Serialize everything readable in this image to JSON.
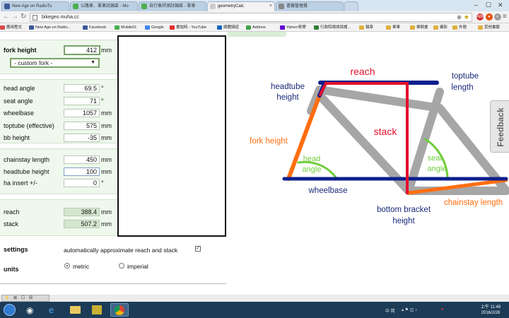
{
  "browser": {
    "tabs": [
      {
        "label": "New Age on RadioTu",
        "color": "#3b5998"
      },
      {
        "label": "公路車．單車討論區 - Mo",
        "color": "#4caf50"
      },
      {
        "label": "自行車評測討論區 - 單車",
        "color": "#4caf50"
      },
      {
        "label": "geometryCalc",
        "color": "#cccccc"
      },
      {
        "label": "書籤管理員",
        "color": "#888888"
      }
    ],
    "url": "bikegeo.muha.cc",
    "window_controls": [
      "‒",
      "☐",
      "✕"
    ]
  },
  "bookmarks": [
    {
      "label": "應用程式",
      "color": "#d94c4c"
    },
    {
      "label": "New Age on Radio...",
      "color": "#3b5998"
    },
    {
      "label": "Facebook",
      "color": "#3b5998"
    },
    {
      "label": "Mobile01",
      "color": "#4caf50"
    },
    {
      "label": "Google",
      "color": "#4285f4"
    },
    {
      "label": "畫說時 - YouTube",
      "color": "#e52d27"
    },
    {
      "label": "媒體頻道",
      "color": "#1565c0"
    },
    {
      "label": "Addons",
      "color": "#43a047"
    },
    {
      "label": "Yahoo!奇摩",
      "color": "#6001d2"
    },
    {
      "label": "行政院環境保護...",
      "color": "#2e7d32"
    },
    {
      "label": "報章",
      "color": "#e0b040"
    },
    {
      "label": "單車",
      "color": "#e0b040"
    },
    {
      "label": "單騎畫",
      "color": "#e0b040"
    },
    {
      "label": "攝影",
      "color": "#e0b040"
    },
    {
      "label": "外語",
      "color": "#e0b040"
    },
    {
      "label": "其他書籤",
      "color": "#e0b040"
    }
  ],
  "form": {
    "fork_height": {
      "label": "fork height",
      "value": "412",
      "unit": "mm"
    },
    "fork_select": "- custom fork -",
    "geometry": [
      {
        "label": "head angle",
        "value": "69.5",
        "unit": "°"
      },
      {
        "label": "seat angle",
        "value": "71",
        "unit": "°"
      },
      {
        "label": "wheelbase",
        "value": "1057",
        "unit": "mm"
      },
      {
        "label": "toptube (effective)",
        "value": "575",
        "unit": "mm"
      },
      {
        "label": "bb height",
        "value": "-35",
        "unit": "mm"
      }
    ],
    "frame": [
      {
        "label": "chainstay length",
        "value": "450",
        "unit": "mm"
      },
      {
        "label": "headtube height",
        "value": "100",
        "unit": "mm"
      },
      {
        "label": "ha insert +/-",
        "value": "0",
        "unit": "°"
      }
    ],
    "results": [
      {
        "label": "reach",
        "value": "388.4",
        "unit": "mm"
      },
      {
        "label": "stack",
        "value": "507.2",
        "unit": "mm"
      }
    ]
  },
  "settings": {
    "label": "settings",
    "auto_approx_text": "automatically approximate reach and stack",
    "auto_approx_checked": true,
    "units_label": "units",
    "unit_options": [
      "metric",
      "imperial"
    ],
    "unit_selected": "metric"
  },
  "feedback_label": "Feedback",
  "diagram": {
    "labels": {
      "reach": "reach",
      "stack": "stack",
      "headtube_1": "headtube",
      "headtube_2": "height",
      "toptube_1": "toptube",
      "toptube_2": "length",
      "fork_height": "fork height",
      "head_angle_1": "head",
      "head_angle_2": "angle",
      "seat_angle_1": "seat",
      "seat_angle_2": "angle",
      "wheelbase": "wheelbase",
      "bottom_bracket_1": "bottom bracket",
      "bottom_bracket_2": "height",
      "chainstay": "chainstay length"
    },
    "colors": {
      "frame": "#a6a6a6",
      "blue": "#0d1f8c",
      "red": "#e3102c",
      "orange": "#ff6e10",
      "green": "#6fce3a",
      "blue_text": "#1a2a7a"
    }
  },
  "taskbar": {
    "mini_tools": "⚡ ⊞ ☐ ☒",
    "lang": "中 简",
    "clock_time": "上午 11:49",
    "clock_date": "2016/2/26"
  }
}
